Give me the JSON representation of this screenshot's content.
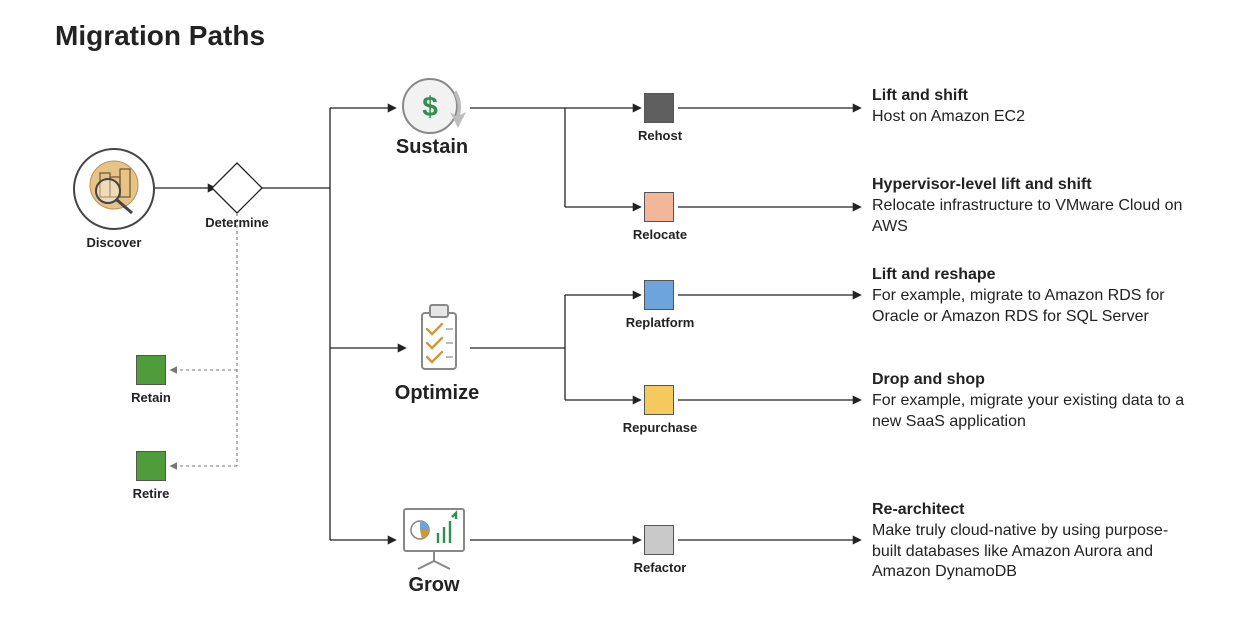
{
  "title": "Migration Paths",
  "nodes": {
    "discover": "Discover",
    "determine": "Determine",
    "sustain": "Sustain",
    "optimize": "Optimize",
    "grow": "Grow",
    "retain": "Retain",
    "retire": "Retire"
  },
  "rboxes": {
    "rehost": "Rehost",
    "relocate": "Relocate",
    "replatform": "Replatform",
    "repurchase": "Repurchase",
    "refactor": "Refactor"
  },
  "desc": {
    "rehost": {
      "h": "Lift and shift",
      "b": "Host on Amazon EC2"
    },
    "relocate": {
      "h": "Hypervisor-level lift and shift",
      "b": "Relocate infrastructure to VMware Cloud on AWS"
    },
    "replatform": {
      "h": "Lift and reshape",
      "b": "For example, migrate to Amazon RDS for Oracle or Amazon RDS for SQL Server"
    },
    "repurchase": {
      "h": "Drop and shop",
      "b": "For example, migrate your existing data to a new SaaS application"
    },
    "grow": {
      "h": "Re-architect",
      "b": "Make truly cloud-native by using purpose-built databases like Amazon Aurora and Amazon DynamoDB"
    }
  },
  "colors": {
    "retain": "#4f9d3a",
    "retire": "#4f9d3a",
    "rehost": "#5f5f5f",
    "relocate": "#f2b699",
    "replatform": "#6ea4dc",
    "repurchase": "#f4c95d",
    "refactor": "#c9c9c9"
  }
}
